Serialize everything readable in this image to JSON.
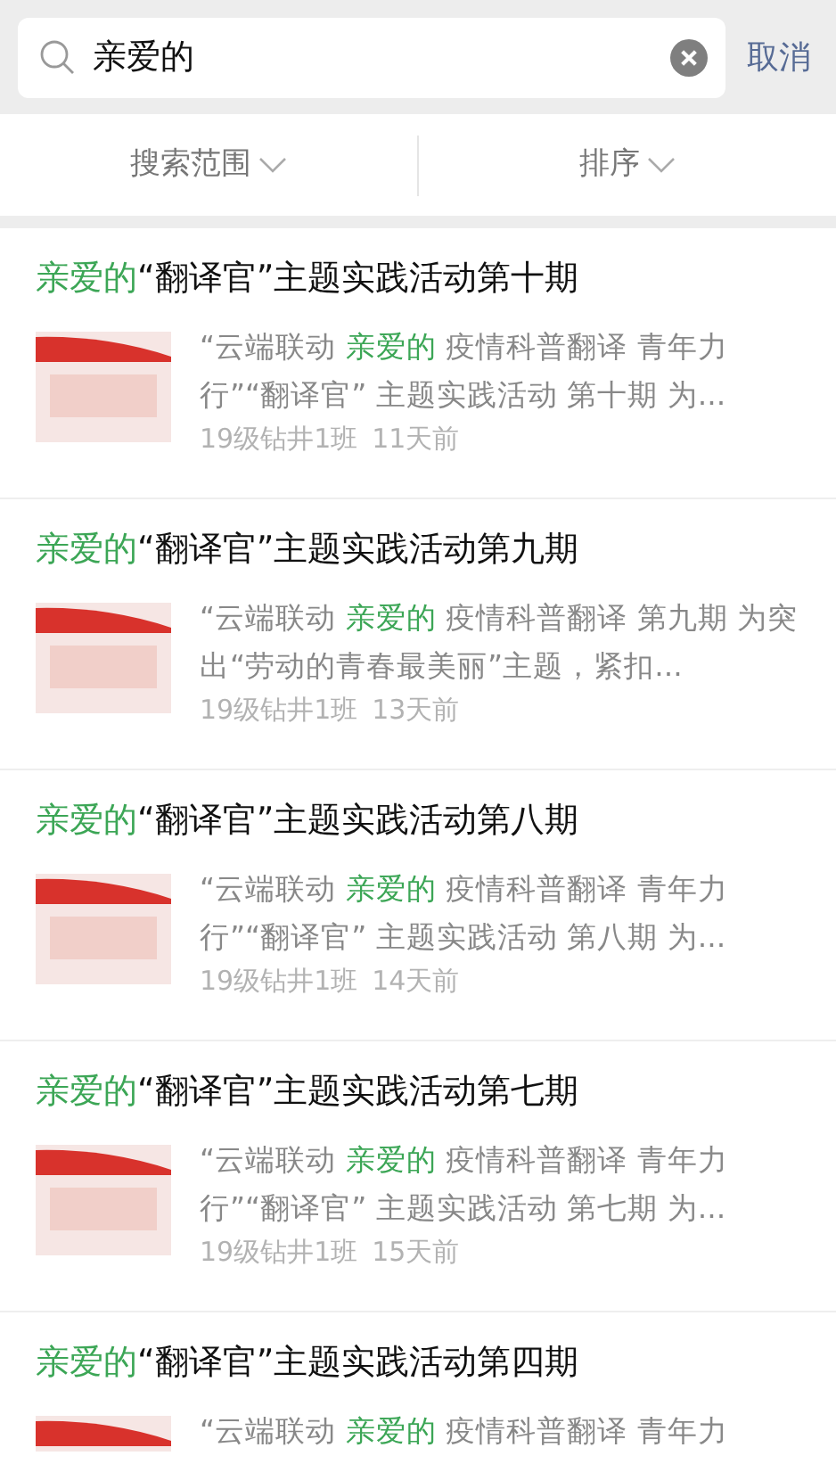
{
  "search": {
    "value": "亲爱的",
    "cancel": "取消"
  },
  "filters": [
    {
      "label": "搜索范围"
    },
    {
      "label": "排序"
    }
  ],
  "results": [
    {
      "title": [
        {
          "text": "亲爱的",
          "highlight": true
        },
        {
          "text": "“翻译官”主题实践活动第十期",
          "highlight": false
        }
      ],
      "snippet": [
        {
          "text": "“云端联动 ",
          "highlight": false
        },
        {
          "text": "亲爱的",
          "highlight": true
        },
        {
          "text": " 疫情科普翻译 青年力行”“翻译官” 主题实践活动 第十期 为...",
          "highlight": false
        }
      ],
      "source": "19级钻井1班",
      "time": "11天前"
    },
    {
      "title": [
        {
          "text": "亲爱的",
          "highlight": true
        },
        {
          "text": "“翻译官”主题实践活动第九期",
          "highlight": false
        }
      ],
      "snippet": [
        {
          "text": "“云端联动 ",
          "highlight": false
        },
        {
          "text": "亲爱的",
          "highlight": true
        },
        {
          "text": " 疫情科普翻译 第九期 为突出“劳动的青春最美丽”主题，紧扣...",
          "highlight": false
        }
      ],
      "source": "19级钻井1班",
      "time": "13天前"
    },
    {
      "title": [
        {
          "text": "亲爱的",
          "highlight": true
        },
        {
          "text": "“翻译官”主题实践活动第八期",
          "highlight": false
        }
      ],
      "snippet": [
        {
          "text": "“云端联动 ",
          "highlight": false
        },
        {
          "text": "亲爱的",
          "highlight": true
        },
        {
          "text": " 疫情科普翻译 青年力行”“翻译官” 主题实践活动 第八期 为...",
          "highlight": false
        }
      ],
      "source": "19级钻井1班",
      "time": "14天前"
    },
    {
      "title": [
        {
          "text": "亲爱的",
          "highlight": true
        },
        {
          "text": "“翻译官”主题实践活动第七期",
          "highlight": false
        }
      ],
      "snippet": [
        {
          "text": "“云端联动 ",
          "highlight": false
        },
        {
          "text": "亲爱的",
          "highlight": true
        },
        {
          "text": " 疫情科普翻译 青年力行”“翻译官” 主题实践活动 第七期 为...",
          "highlight": false
        }
      ],
      "source": "19级钻井1班",
      "time": "15天前"
    },
    {
      "title": [
        {
          "text": "亲爱的",
          "highlight": true
        },
        {
          "text": "“翻译官”主题实践活动第四期",
          "highlight": false
        }
      ],
      "snippet": [
        {
          "text": "“云端联动 ",
          "highlight": false
        },
        {
          "text": "亲爱的",
          "highlight": true
        },
        {
          "text": " 疫情科普翻译 青年力",
          "highlight": false
        }
      ]
    }
  ]
}
